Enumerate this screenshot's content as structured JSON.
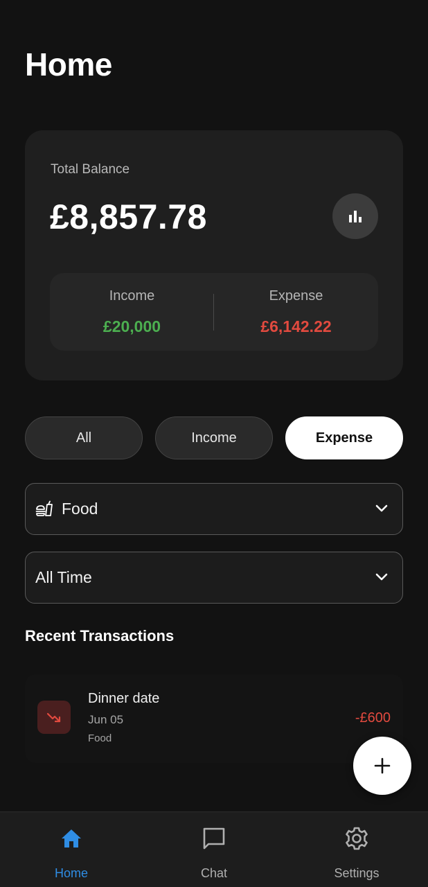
{
  "header": {
    "title": "Home"
  },
  "balance_card": {
    "label": "Total Balance",
    "amount": "£8,857.78",
    "stats_icon": "bar-chart-icon",
    "income": {
      "label": "Income",
      "value": "£20,000",
      "color": "#4caf50"
    },
    "expense": {
      "label": "Expense",
      "value": "£6,142.22",
      "color": "#e24a3f"
    }
  },
  "filters": {
    "tabs": [
      {
        "label": "All",
        "active": false
      },
      {
        "label": "Income",
        "active": false
      },
      {
        "label": "Expense",
        "active": true
      }
    ]
  },
  "category_dropdown": {
    "icon": "fastfood-icon",
    "value": "Food"
  },
  "time_dropdown": {
    "value": "All Time"
  },
  "recent": {
    "title": "Recent Transactions",
    "transactions": [
      {
        "title": "Dinner date",
        "date": "Jun 05",
        "category": "Food",
        "amount": "-£600",
        "icon": "trending-down-icon"
      }
    ]
  },
  "fab": {
    "icon": "plus-icon"
  },
  "bottom_nav": {
    "accent": "#2f8de4",
    "items": [
      {
        "label": "Home",
        "icon": "home-icon",
        "active": true
      },
      {
        "label": "Chat",
        "icon": "chat-bubble-icon",
        "active": false
      },
      {
        "label": "Settings",
        "icon": "gear-icon",
        "active": false
      }
    ]
  }
}
